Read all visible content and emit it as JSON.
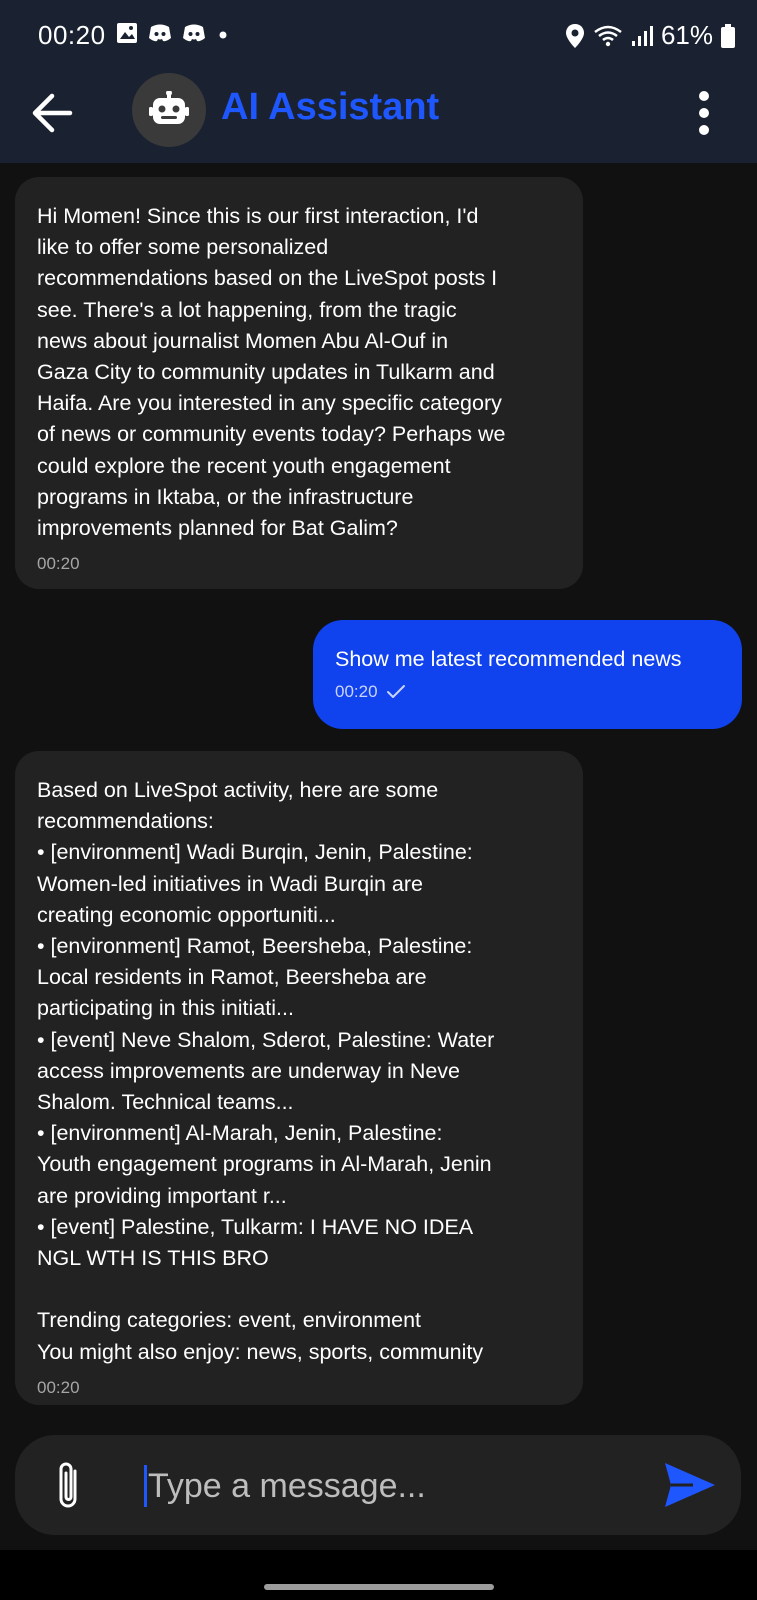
{
  "status_bar": {
    "time": "00:20",
    "battery_percent": "61%",
    "left_icons": [
      "gallery-icon",
      "discord-icon",
      "discord-icon",
      "dot-icon"
    ],
    "right_icons": [
      "location-icon",
      "wifi-icon",
      "signal-icon",
      "battery-icon"
    ]
  },
  "header": {
    "title": "AI Assistant",
    "avatar_icon": "robot-icon",
    "accent_color": "#1f57ff",
    "background_color": "#1a2231"
  },
  "messages": [
    {
      "from": "assistant",
      "text": "Hi Momen! Since this is our first interaction, I'd\nlike to offer some personalized\nrecommendations based on the LiveSpot posts I\nsee. There's a lot happening, from the tragic\nnews about journalist Momen Abu Al-Ouf in\nGaza City to community updates in Tulkarm and\nHaifa. Are you interested in any specific category\nof news or community events today? Perhaps we\ncould explore the recent youth engagement\nprograms in Iktaba, or the infrastructure\nimprovements planned for Bat Galim?",
      "time": "00:20"
    },
    {
      "from": "user",
      "text": "Show me latest recommended news",
      "time": "00:20",
      "status_icon": "check-icon"
    },
    {
      "from": "assistant",
      "text": "Based on LiveSpot activity, here are some\nrecommendations:\n• [environment] Wadi Burqin, Jenin, Palestine:\nWomen-led initiatives in Wadi Burqin are\ncreating economic opportuniti...\n• [environment] Ramot, Beersheba, Palestine:\nLocal residents in Ramot, Beersheba are\nparticipating in this initiati...\n• [event] Neve Shalom, Sderot, Palestine: Water\naccess improvements are underway in Neve\nShalom. Technical teams...\n• [environment] Al-Marah, Jenin, Palestine:\nYouth engagement programs in Al-Marah, Jenin\nare providing important r...\n• [event] Palestine, Tulkarm: I HAVE NO IDEA\nNGL WTH IS THIS BRO\n\nTrending categories: event, environment\nYou might also enjoy: news, sports, community",
      "time": "00:20"
    }
  ],
  "composer": {
    "placeholder": "Type a message...",
    "value": ""
  },
  "colors": {
    "user_bubble": "#1042ee",
    "assistant_bubble": "#222222",
    "chat_background": "#111111"
  }
}
